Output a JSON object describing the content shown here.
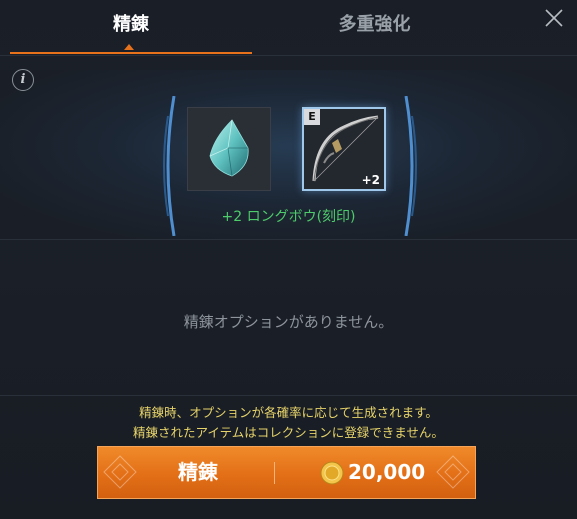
{
  "tabs": {
    "refine": "精錬",
    "multi_enhance": "多重強化"
  },
  "info_label": "i",
  "item_name": "+2 ロングボウ(刻印)",
  "bow_slot": {
    "grade": "E",
    "plus": "+2"
  },
  "no_options_text": "精錬オプションがありません。",
  "notice": {
    "line1": "精錬時、オプションが各確率に応じて生成されます。",
    "line2": "精錬されたアイテムはコレクションに登録できません。"
  },
  "action": {
    "label": "精錬",
    "cost": "20,000"
  },
  "icons": {
    "close": "close-icon",
    "info": "info-icon",
    "coin": "coin-icon",
    "material": "crystal-icon",
    "bow": "bow-icon"
  },
  "colors": {
    "accent": "#e8721c",
    "item_name": "#4ecb6a",
    "notice": "#e6d36a",
    "slot_border": "#9fc8ea"
  }
}
